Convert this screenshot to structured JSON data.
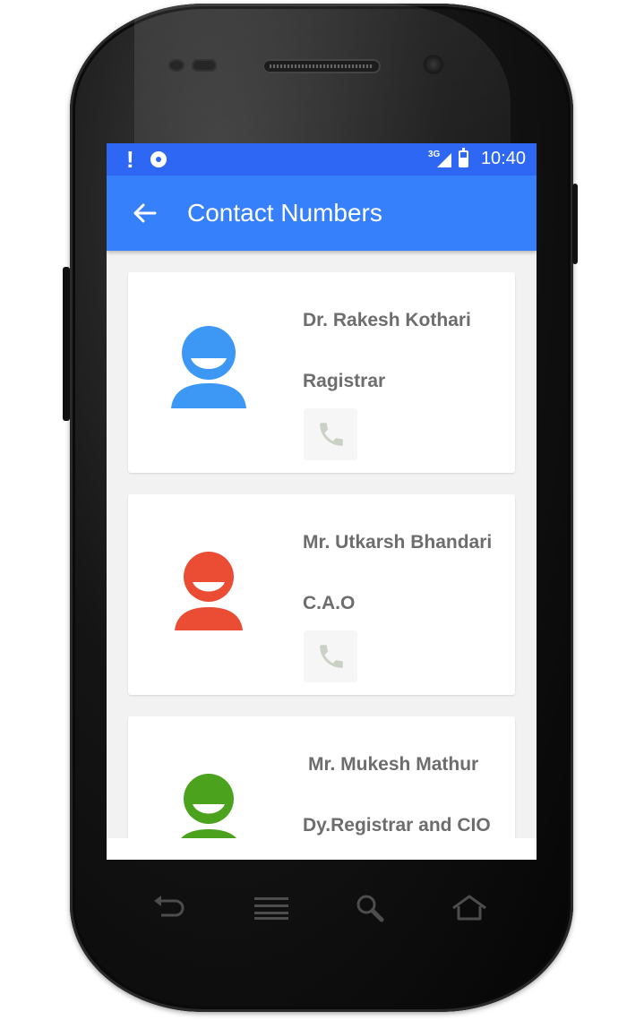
{
  "status_bar": {
    "time": "10:40",
    "network": "3G",
    "icons": [
      "notification-alert-icon",
      "sync-disc-icon",
      "signal-icon",
      "battery-icon"
    ]
  },
  "app_bar": {
    "title": "Contact Numbers",
    "back_icon": "arrow-back-icon",
    "color": "#3780fb",
    "status_color": "#2f67f5"
  },
  "contacts": [
    {
      "name": "Dr. Rakesh Kothari",
      "role": "Ragistrar",
      "avatar_color": "#3d97f4",
      "icon": "phone-icon"
    },
    {
      "name": "Mr. Utkarsh Bhandari",
      "role": "C.A.O",
      "avatar_color": "#ea4c34",
      "icon": "phone-icon"
    },
    {
      "name": "Mr. Mukesh Mathur",
      "role": "Dy.Registrar and CIO",
      "avatar_color": "#4aa21d",
      "icon": "phone-icon"
    }
  ],
  "nav_keys": [
    "back-key-icon",
    "menu-key-icon",
    "search-key-icon",
    "home-key-icon"
  ]
}
